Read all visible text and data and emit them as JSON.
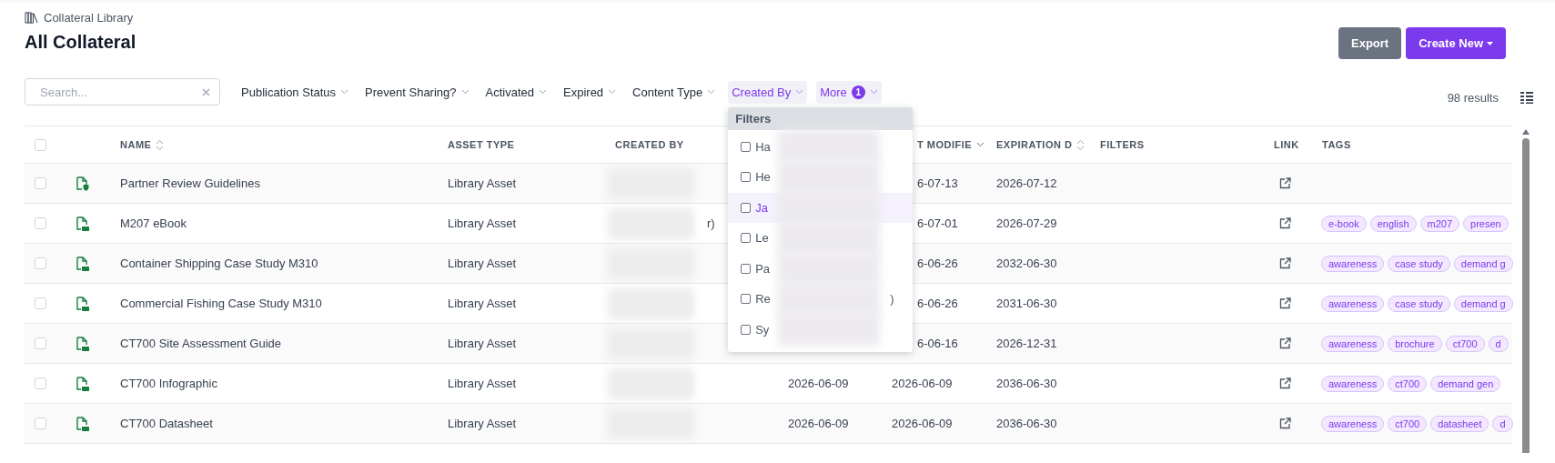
{
  "breadcrumb": {
    "label": "Collateral Library"
  },
  "title": "All Collateral",
  "actions": [
    {
      "label": "Export",
      "kind": "secondary"
    },
    {
      "label": "Create New",
      "kind": "primary"
    }
  ],
  "search": {
    "placeholder": "Search..."
  },
  "filters": [
    {
      "label": "Publication Status",
      "active": false
    },
    {
      "label": "Prevent Sharing?",
      "active": false
    },
    {
      "label": "Activated",
      "active": false
    },
    {
      "label": "Expired",
      "active": false
    },
    {
      "label": "Content Type",
      "active": false
    },
    {
      "label": "Created By",
      "active": true,
      "open": true
    },
    {
      "label": "More",
      "active": true,
      "count": "1"
    }
  ],
  "dropdown": {
    "header": "Filters",
    "items": [
      {
        "label": "Ha",
        "checked": false,
        "highlighted": false
      },
      {
        "label": "He",
        "checked": false,
        "highlighted": false
      },
      {
        "label": "Ja",
        "checked": false,
        "highlighted": true
      },
      {
        "label": "Le",
        "checked": false,
        "highlighted": false
      },
      {
        "label": "Pa",
        "checked": false,
        "highlighted": false
      },
      {
        "label": "Re",
        "checked": false,
        "highlighted": false,
        "tail": ")"
      },
      {
        "label": "Sy",
        "checked": false,
        "highlighted": false
      }
    ]
  },
  "results": "98 results",
  "table": {
    "select_all": {
      "checked": false
    },
    "columns": [
      {
        "label": "NAME",
        "sortable": true,
        "sorted": false
      },
      {
        "label": "ASSET TYPE"
      },
      {
        "label": "CREATED BY"
      },
      {
        "label": "T MODIFIE",
        "sortable": true,
        "sorted": true
      },
      {
        "label": "EXPIRATION D",
        "sortable": true,
        "sorted": false
      },
      {
        "label": "FILTERS"
      },
      {
        "label": "LINK"
      },
      {
        "label": "TAGS"
      }
    ],
    "rows": [
      {
        "kind": "shield",
        "checked": false,
        "name": "Partner Review Guidelines",
        "asset_type": "Library Asset",
        "redacted": true,
        "modified": "6-07-13",
        "expiration": "2026-07-12",
        "tags": []
      },
      {
        "kind": "pdf",
        "checked": false,
        "name": "M207 eBook",
        "asset_type": "Library Asset",
        "redacted": true,
        "created_by_tail": "r)",
        "modified": "6-07-01",
        "expiration": "2026-07-29",
        "tags": [
          "e-book",
          "english",
          "m207",
          "presen"
        ]
      },
      {
        "kind": "pdf",
        "checked": false,
        "name": "Container Shipping Case Study M310",
        "asset_type": "Library Asset",
        "redacted": true,
        "modified": "6-06-26",
        "expiration": "2032-06-30",
        "tags": [
          "awareness",
          "case study",
          "demand g"
        ]
      },
      {
        "kind": "pdf",
        "checked": false,
        "name": "Commercial Fishing Case Study M310",
        "asset_type": "Library Asset",
        "redacted": true,
        "modified": "6-06-26",
        "expiration": "2031-06-30",
        "tags": [
          "awareness",
          "case study",
          "demand g"
        ]
      },
      {
        "kind": "pdf",
        "checked": false,
        "name": "CT700 Site Assessment Guide",
        "asset_type": "Library Asset",
        "redacted": true,
        "modified": "6-06-16",
        "expiration": "2026-12-31",
        "tags": [
          "awareness",
          "brochure",
          "ct700",
          "d"
        ]
      },
      {
        "kind": "pdf",
        "checked": false,
        "name": "CT700 Infographic",
        "asset_type": "Library Asset",
        "redacted": true,
        "date_created": "2026-06-09",
        "modified": "2026-06-09",
        "expiration": "2036-06-30",
        "tags": [
          "awareness",
          "ct700",
          "demand gen"
        ]
      },
      {
        "kind": "pdf",
        "checked": false,
        "name": "CT700 Datasheet",
        "asset_type": "Library Asset",
        "redacted": true,
        "date_created": "2026-06-09",
        "modified": "2026-06-09",
        "expiration": "2036-06-30",
        "tags": [
          "awareness",
          "ct700",
          "datasheet",
          "d"
        ]
      }
    ]
  }
}
